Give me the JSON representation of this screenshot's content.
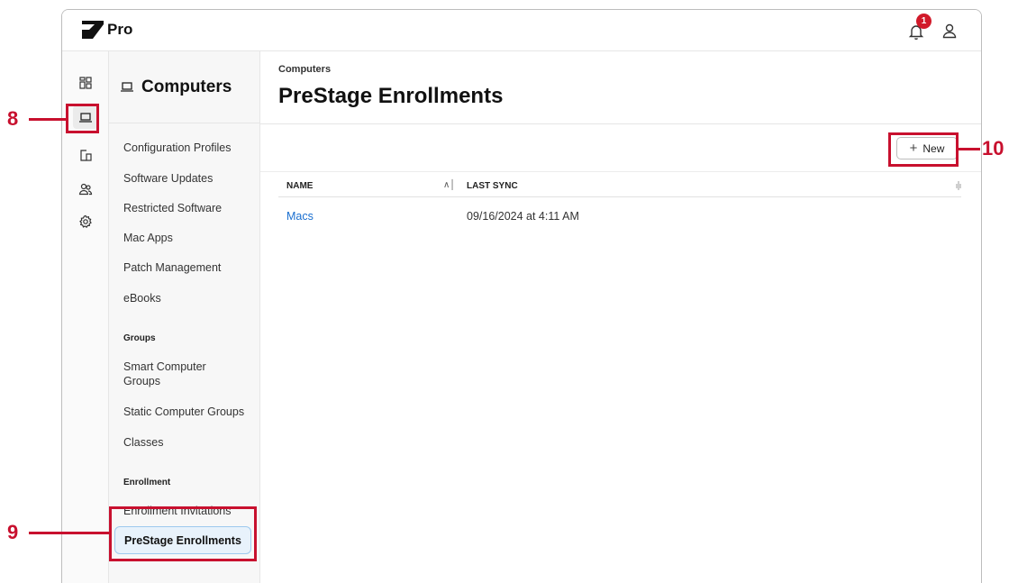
{
  "app": {
    "brand": "Pro",
    "notification_count": "1"
  },
  "rail": {
    "items": [
      {
        "icon": "dashboard-icon"
      },
      {
        "icon": "laptop-icon",
        "active": true
      },
      {
        "icon": "devices-icon"
      },
      {
        "icon": "users-icon"
      },
      {
        "icon": "gear-icon"
      }
    ]
  },
  "subnav": {
    "title": "Computers",
    "items": [
      "Configuration Profiles",
      "Software Updates",
      "Restricted Software",
      "Mac Apps",
      "Patch Management",
      "eBooks"
    ],
    "groups_label": "Groups",
    "groups": [
      "Smart Computer Groups",
      "Static Computer Groups",
      "Classes"
    ],
    "enrollment_label": "Enrollment",
    "enrollment": [
      "Enrollment Invitations",
      "PreStage Enrollments"
    ]
  },
  "main": {
    "breadcrumb": "Computers",
    "title": "PreStage Enrollments",
    "new_button": "New",
    "columns": [
      "NAME",
      "LAST SYNC"
    ],
    "rows": [
      {
        "name": "Macs",
        "last_sync": "09/16/2024 at 4:11 AM"
      }
    ]
  },
  "callouts": [
    "8",
    "9",
    "10"
  ],
  "colors": {
    "accent_link": "#1a6fd0",
    "callout": "#c8102e",
    "badge": "#d11a2a"
  }
}
